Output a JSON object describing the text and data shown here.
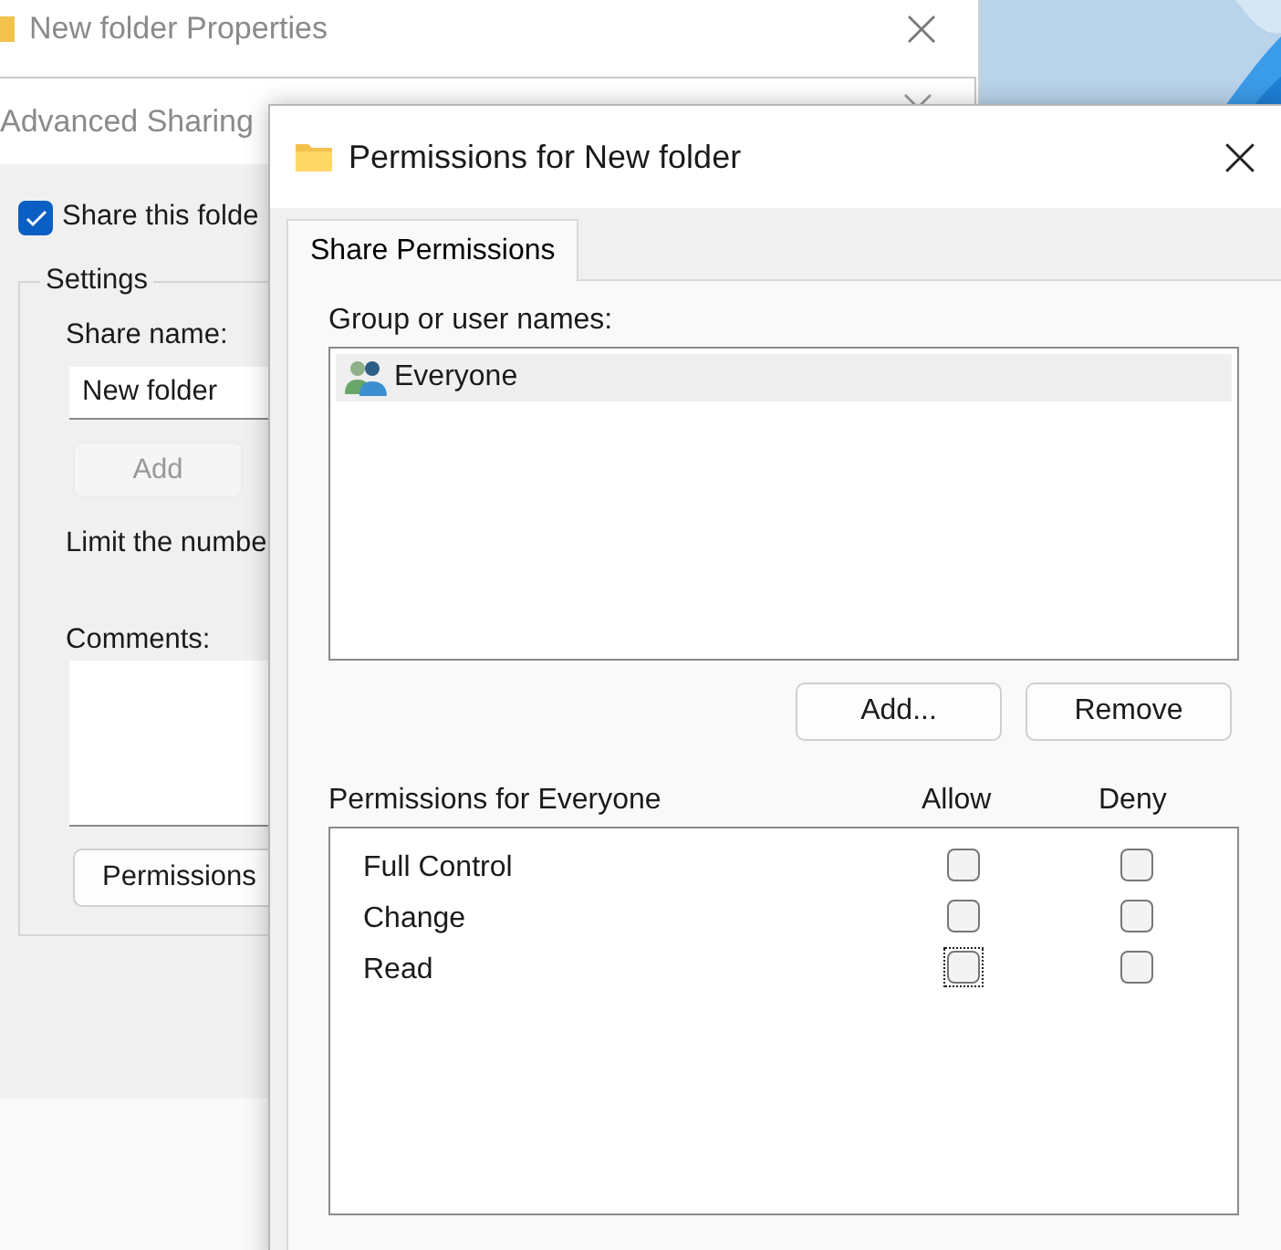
{
  "properties_window": {
    "title": "New folder Properties"
  },
  "advanced_sharing": {
    "title": "Advanced Sharing",
    "share_checkbox": {
      "label": "Share this folde",
      "checked": true
    },
    "settings": {
      "legend": "Settings",
      "share_name_label": "Share name:",
      "share_name_value": "New folder",
      "add_button": {
        "label": "Add",
        "disabled": true
      },
      "limit_label": "Limit the numbe",
      "comments_label": "Comments:",
      "permissions_button": "Permissions"
    }
  },
  "permissions_window": {
    "title": "Permissions for New folder",
    "tabs": [
      {
        "label": "Share Permissions",
        "selected": true
      }
    ],
    "group_label": "Group or user names:",
    "users": [
      {
        "name": "Everyone",
        "selected": true
      }
    ],
    "buttons": [
      "Add...",
      "Remove"
    ],
    "permissions_label": "Permissions for Everyone",
    "columns": [
      "Allow",
      "Deny"
    ],
    "permissions": [
      {
        "name": "Full Control",
        "allow": false,
        "deny": false,
        "allow_focused": false
      },
      {
        "name": "Change",
        "allow": false,
        "deny": false,
        "allow_focused": false
      },
      {
        "name": "Read",
        "allow": false,
        "deny": false,
        "allow_focused": true
      }
    ]
  }
}
